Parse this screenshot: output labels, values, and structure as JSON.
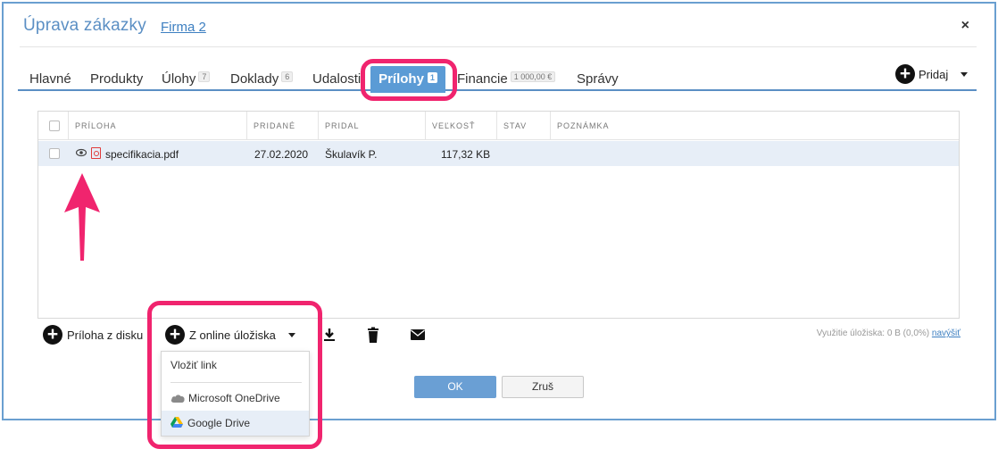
{
  "dialog": {
    "title": "Úprava zákazky",
    "company_link": "Firma 2",
    "close_label": "×"
  },
  "tabs": [
    {
      "label": "Hlavné",
      "badge": ""
    },
    {
      "label": "Produkty",
      "badge": ""
    },
    {
      "label": "Úlohy",
      "badge": "7"
    },
    {
      "label": "Doklady",
      "badge": "6"
    },
    {
      "label": "Udalosti",
      "badge": ""
    },
    {
      "label": "Prílohy",
      "badge": "1",
      "active": true
    },
    {
      "label": "Financie",
      "badge": "1 000,00 €"
    },
    {
      "label": "Správy",
      "badge": ""
    }
  ],
  "add_menu": {
    "label": "Pridaj"
  },
  "grid": {
    "columns": [
      "PRÍLOHA",
      "PRIDANÉ",
      "PRIDAL",
      "VEĽKOSŤ",
      "STAV",
      "POZNÁMKA"
    ],
    "rows": [
      {
        "name": "specifikacia.pdf",
        "added": "27.02.2020",
        "added_by": "Škulavík P.",
        "size": "117,32 KB",
        "status": "",
        "note": ""
      }
    ]
  },
  "toolbar": {
    "from_disk": "Príloha z disku",
    "from_online": "Z online úložiska",
    "usage_text": "Využitie úložiska: 0 B (0,0%)",
    "usage_link": "navýšiť"
  },
  "dropdown": {
    "items": [
      "Vložiť link",
      "Microsoft OneDrive",
      "Google Drive"
    ]
  },
  "buttons": {
    "ok": "OK",
    "cancel": "Zruš"
  },
  "colors": {
    "accent": "#5b9bd5",
    "highlight": "#f0246e",
    "selected_row": "#e7eef7"
  }
}
